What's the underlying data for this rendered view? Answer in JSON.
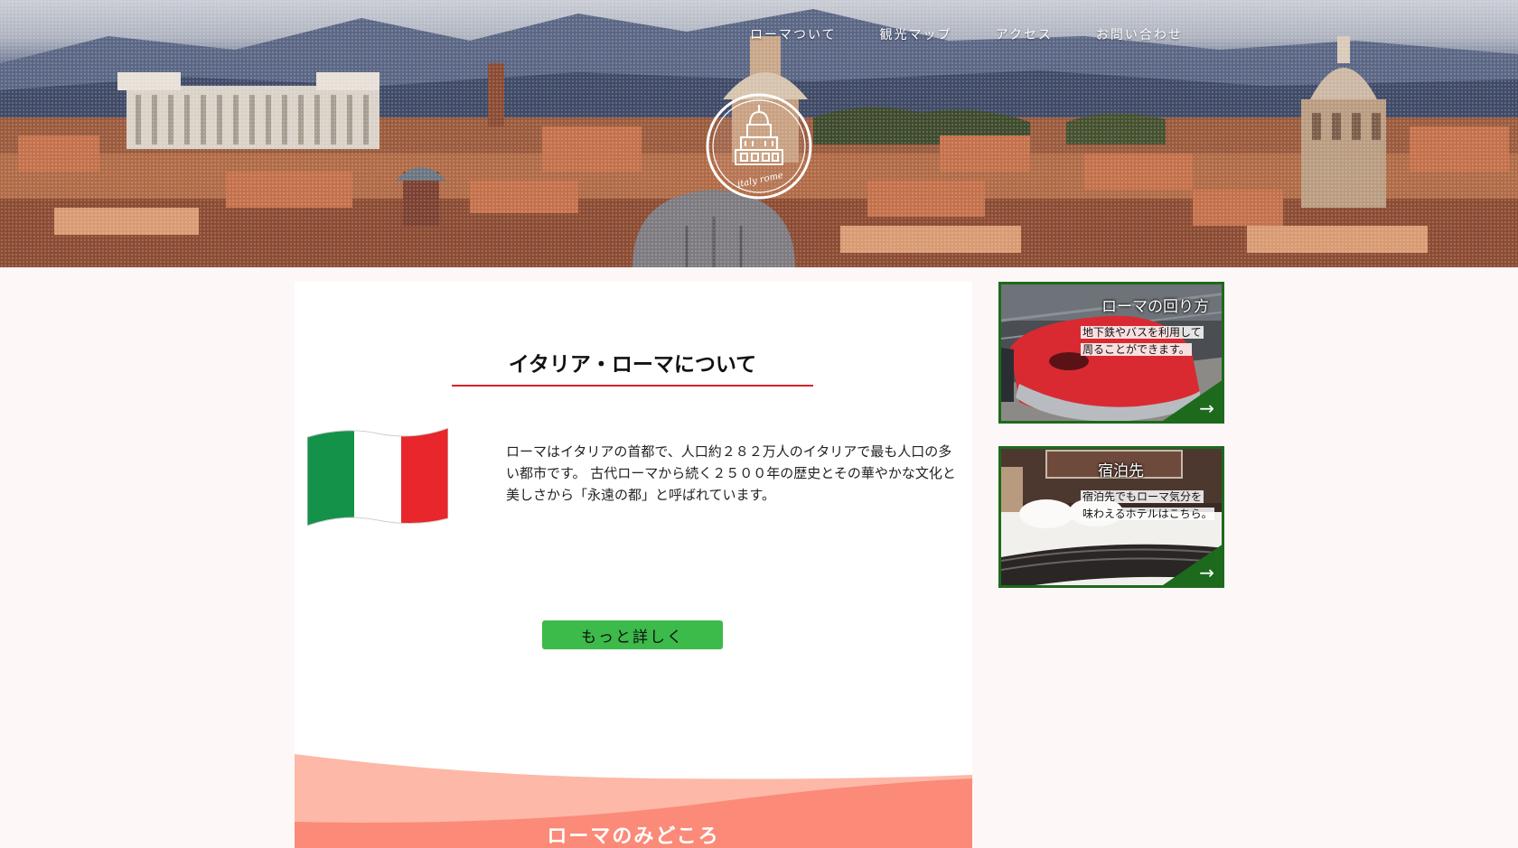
{
  "nav": {
    "items": [
      "ローマついて",
      "観光マップ",
      "アクセス",
      "お問い合わせ"
    ]
  },
  "logo": {
    "text": "italy rome"
  },
  "about": {
    "title": "イタリア・ローマについて",
    "text": "ローマはイタリアの首都で、人口約２８２万人のイタリアで最も人口の多い都市です。 古代ローマから続く２５００年の歴史とその華やかな文化と美しさから「永遠の都」と呼ばれています。",
    "button": "もっと詳しく"
  },
  "highlights": {
    "title": "ローマのみどころ"
  },
  "cards": [
    {
      "title": "ローマの回り方",
      "desc_line1": "地下鉄やバスを利用して",
      "desc_line2": "周ることができます。",
      "arrow": "→"
    },
    {
      "title": "宿泊先",
      "desc_line1": "宿泊先でもローマ気分を",
      "desc_line2": "味わえるホテルはこちら。",
      "arrow": "→"
    }
  ],
  "colors": {
    "accent_red": "#d8222a",
    "button_green": "#3cba4a",
    "card_border": "#1d6a1d",
    "wave_light": "#fdb8a8",
    "wave_dark": "#fb8a78",
    "flag_green": "#15924a",
    "flag_red": "#e8262b"
  }
}
